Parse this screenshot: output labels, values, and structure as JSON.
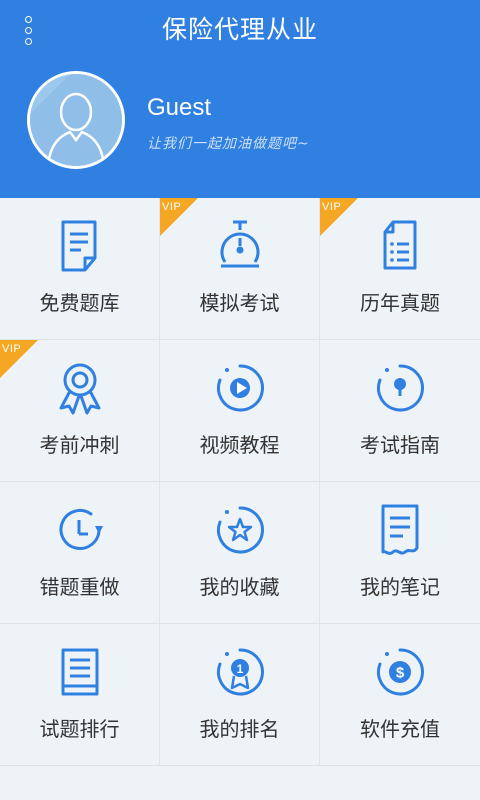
{
  "header": {
    "title": "保险代理从业",
    "username": "Guest",
    "slogan": "让我们一起加油做题吧~",
    "background_color": "#2f80e1"
  },
  "icons": {
    "menu": "more-vertical-icon",
    "avatar": "user-avatar-icon"
  },
  "badge": {
    "vip_label": "VIP",
    "color": "#f5a623"
  },
  "accent_color": "#2f80e1",
  "items": [
    {
      "label": "免费题库",
      "icon": "document-icon",
      "vip": false
    },
    {
      "label": "模拟考试",
      "icon": "stopwatch-icon",
      "vip": true
    },
    {
      "label": "历年真题",
      "icon": "paper-list-icon",
      "vip": true
    },
    {
      "label": "考前冲刺",
      "icon": "award-ribbon-icon",
      "vip": true
    },
    {
      "label": "视频教程",
      "icon": "play-circle-icon",
      "vip": false
    },
    {
      "label": "考试指南",
      "icon": "compass-pin-icon",
      "vip": false
    },
    {
      "label": "错题重做",
      "icon": "clock-redo-icon",
      "vip": false
    },
    {
      "label": "我的收藏",
      "icon": "star-circle-icon",
      "vip": false
    },
    {
      "label": "我的笔记",
      "icon": "receipt-notes-icon",
      "vip": false
    },
    {
      "label": "试题排行",
      "icon": "ranking-list-icon",
      "vip": false
    },
    {
      "label": "我的排名",
      "icon": "medal-rank-icon",
      "vip": false
    },
    {
      "label": "软件充值",
      "icon": "coin-recharge-icon",
      "vip": false
    }
  ]
}
